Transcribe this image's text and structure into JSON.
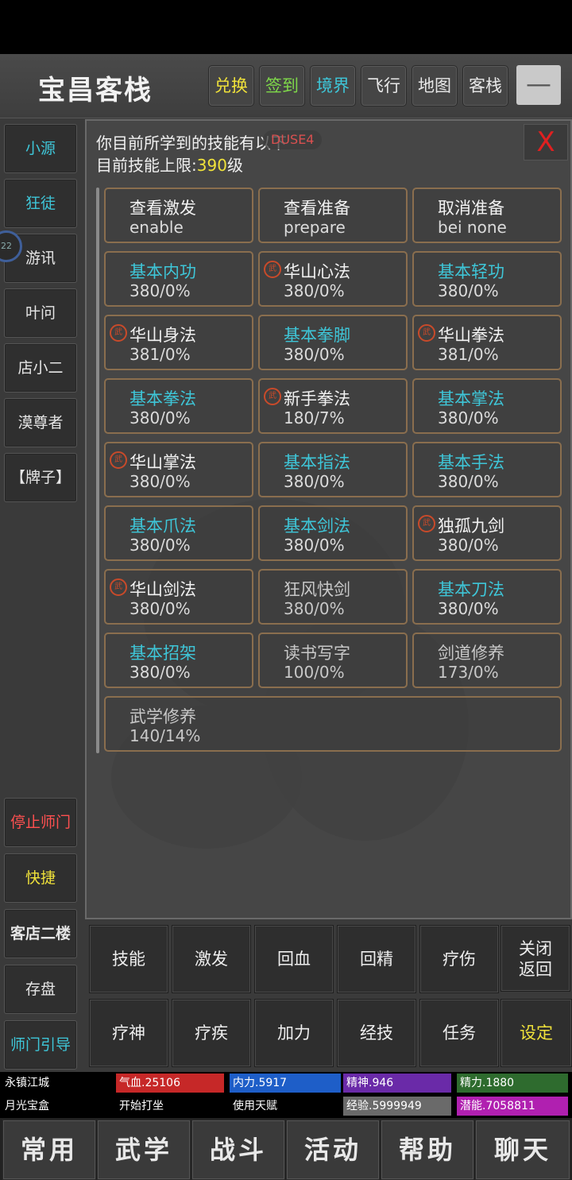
{
  "header": {
    "title": "宝昌客栈",
    "buttons": [
      "兑换",
      "签到",
      "境界",
      "飞行",
      "地图",
      "客栈"
    ],
    "minimize": "—"
  },
  "sidebar": {
    "top": [
      "小源",
      "狂徒",
      "游讯",
      "叶问",
      "店小二",
      "漠尊者",
      "【牌子】"
    ],
    "badge": "22",
    "bottom": [
      "停止师门",
      "快捷",
      "客店二楼",
      "存盘",
      "师门引导"
    ]
  },
  "panel": {
    "info_line1": "你目前所学到的技能有以下",
    "overlay_tag": "DUSE4",
    "info_line2_prefix": "目前技能上限:",
    "info_line2_value": "390",
    "info_line2_suffix": "级",
    "close": "X",
    "mark": "武",
    "commands": [
      {
        "name": "查看激发",
        "value": "enable"
      },
      {
        "name": "查看准备",
        "value": "prepare"
      },
      {
        "name": "取消准备",
        "value": "bei none"
      }
    ],
    "skills": [
      {
        "name": "基本内功",
        "value": "380/0%"
      },
      {
        "name": "华山心法",
        "value": "380/0%"
      },
      {
        "name": "基本轻功",
        "value": "380/0%"
      },
      {
        "name": "华山身法",
        "value": "381/0%"
      },
      {
        "name": "基本拳脚",
        "value": "380/0%"
      },
      {
        "name": "华山拳法",
        "value": "381/0%"
      },
      {
        "name": "基本拳法",
        "value": "380/0%"
      },
      {
        "name": "新手拳法",
        "value": "180/7%"
      },
      {
        "name": "基本掌法",
        "value": "380/0%"
      },
      {
        "name": "华山掌法",
        "value": "380/0%"
      },
      {
        "name": "基本指法",
        "value": "380/0%"
      },
      {
        "name": "基本手法",
        "value": "380/0%"
      },
      {
        "name": "基本爪法",
        "value": "380/0%"
      },
      {
        "name": "基本剑法",
        "value": "380/0%"
      },
      {
        "name": "独孤九剑",
        "value": "380/0%"
      },
      {
        "name": "华山剑法",
        "value": "380/0%"
      },
      {
        "name": "狂风快剑",
        "value": "380/0%"
      },
      {
        "name": "基本刀法",
        "value": "380/0%"
      },
      {
        "name": "基本招架",
        "value": "380/0%"
      },
      {
        "name": "读书写字",
        "value": "100/0%"
      },
      {
        "name": "剑道修养",
        "value": "173/0%"
      },
      {
        "name": "武学修养",
        "value": "140/14%"
      }
    ]
  },
  "actions": {
    "row1": [
      "技能",
      "激发",
      "回血",
      "回精",
      "疗伤"
    ],
    "close_line1": "关闭",
    "close_line2": "返回",
    "row2": [
      "疗神",
      "疗疾",
      "加力",
      "经技",
      "任务",
      "设定"
    ]
  },
  "status": {
    "location": "永镇江城",
    "hp": "气血.25106",
    "mp": "内力.5917",
    "spirit": "精神.946",
    "energy": "精力.1880",
    "item": "月光宝盒",
    "meditate": "开始打坐",
    "talent": "使用天赋",
    "exp": "经验.5999949",
    "potential": "潜能.7058811",
    "colors": {
      "hp": "#c62828",
      "mp": "#1e5ec8",
      "spirit": "#6a2aa8",
      "energy": "#2e6b2e",
      "exp": "#6a6a6a",
      "potential": "#b020b0"
    }
  },
  "nav": [
    "常用",
    "武学",
    "战斗",
    "活动",
    "帮助",
    "聊天"
  ]
}
